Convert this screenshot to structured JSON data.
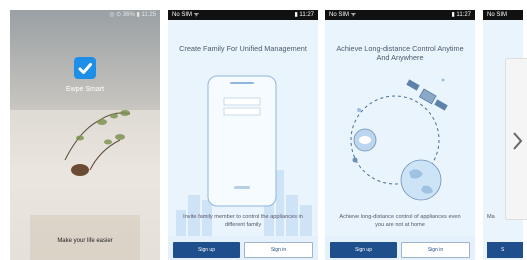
{
  "splash": {
    "status_icons": "◎ ⊙ 36% ▮ 11:25",
    "app_name": "Ewpe Smart",
    "tagline": "Make your life easier"
  },
  "screens": [
    {
      "status_left": "No SIM ᯤ",
      "status_right": "▮ 11:27",
      "title": "Create Family For Unified Management",
      "caption": "Invite family member to control the appliances in different family",
      "signup": "Sign up",
      "signin": "Sign in"
    },
    {
      "status_left": "No SIM ᯤ",
      "status_right": "▮ 11:27",
      "title": "Achieve Long-distance Control Anytime And Anywhere",
      "caption": "Achieve long-distance control of appliances even you are not at home",
      "signup": "Sign up",
      "signin": "Sign in"
    }
  ],
  "partial_screen": {
    "status_left": "No SIM",
    "caption_fragment": "Ma",
    "signup_fragment": "S"
  },
  "colors": {
    "primary": "#1f4e8c",
    "background": "#e9f4fd",
    "logo": "#1e8fe8"
  },
  "icons": [
    "chevron-right-icon",
    "phone-illustration",
    "satellite-icon",
    "cloud-icon",
    "globe-icon"
  ]
}
